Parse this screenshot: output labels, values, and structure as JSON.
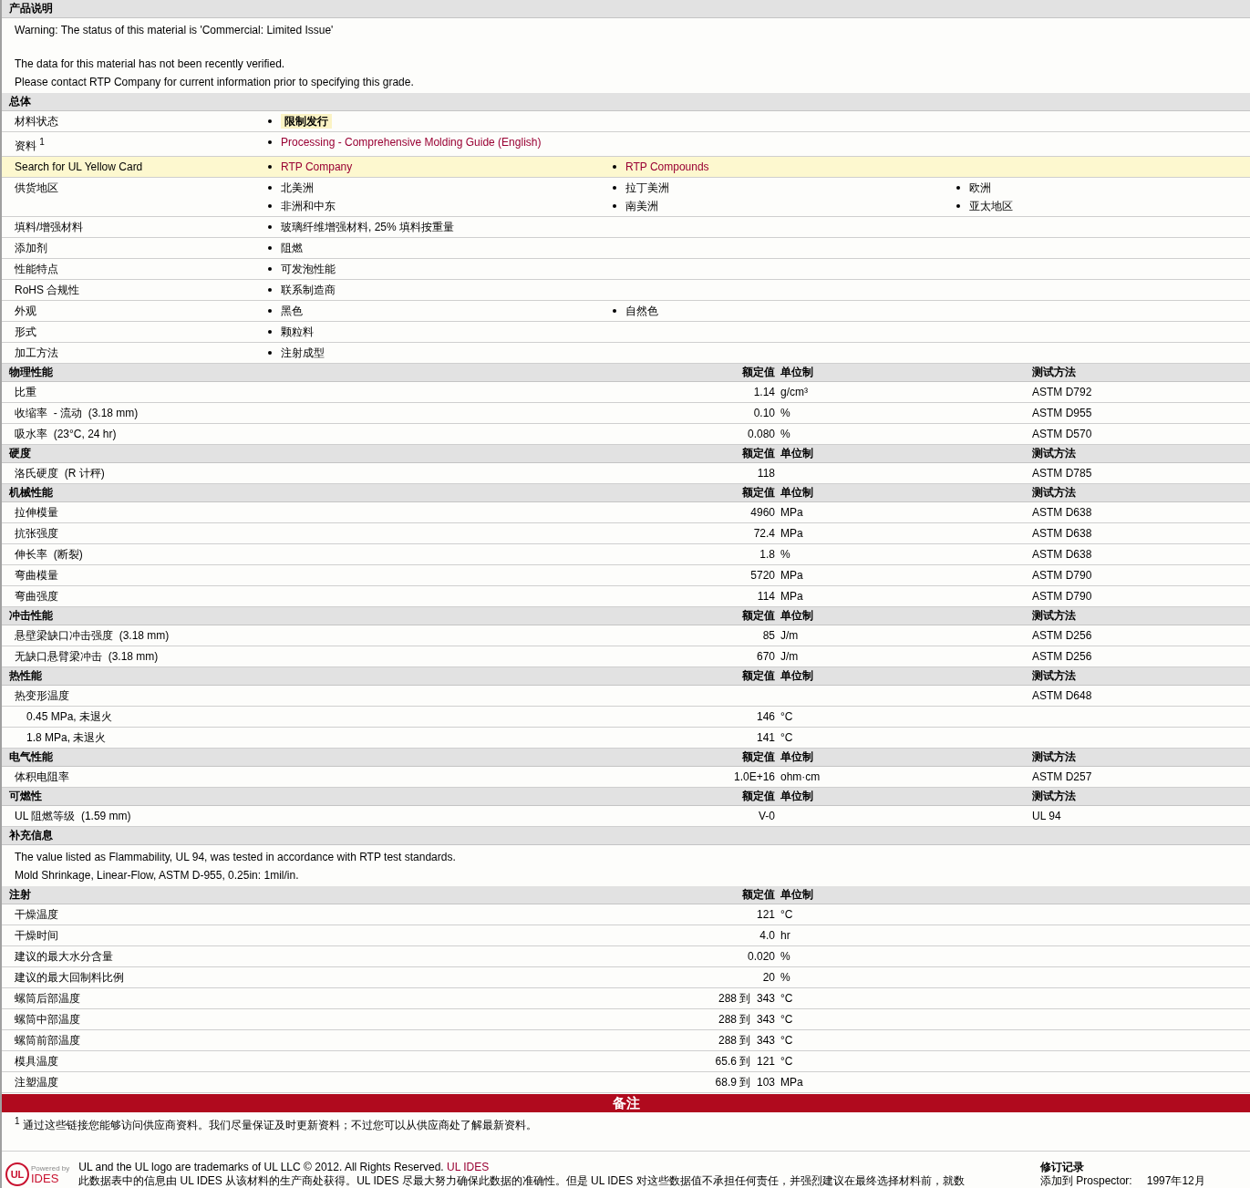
{
  "sections": [
    {
      "kind": "notes",
      "title": "产品说明",
      "paragraphs": [
        [
          "Warning: The status of this material is 'Commercial: Limited Issue'"
        ],
        [
          "The data for this material has not been recently verified.",
          "Please contact RTP Company for current information prior to specifying this grade."
        ]
      ]
    },
    {
      "kind": "general",
      "title": "总体",
      "rows": [
        {
          "label": "材料状态",
          "highlighted": false,
          "columns": [
            [
              {
                "kind": "status",
                "text": "限制发行"
              }
            ]
          ]
        },
        {
          "label": "资料 $^{1}$",
          "highlighted": false,
          "columns": [
            [
              {
                "kind": "link",
                "text": "Processing - Comprehensive Molding Guide (English)"
              }
            ]
          ]
        },
        {
          "label": "Search for UL Yellow Card",
          "highlighted": true,
          "columns": [
            [
              {
                "kind": "link",
                "text": "RTP Company"
              }
            ],
            [
              {
                "kind": "link",
                "text": "RTP Compounds"
              }
            ]
          ]
        },
        {
          "label": "供货地区",
          "highlighted": false,
          "columns": [
            [
              {
                "kind": "text",
                "text": "北美洲"
              },
              {
                "kind": "text",
                "text": "非洲和中东"
              }
            ],
            [
              {
                "kind": "text",
                "text": "拉丁美洲"
              },
              {
                "kind": "text",
                "text": "南美洲"
              }
            ],
            [
              {
                "kind": "text",
                "text": "欧洲"
              },
              {
                "kind": "text",
                "text": "亚太地区"
              }
            ]
          ]
        },
        {
          "label": "填料/增强材料",
          "highlighted": false,
          "columns": [
            [
              {
                "kind": "text",
                "text": "玻璃纤维增强材料, 25% 填料按重量"
              }
            ]
          ]
        },
        {
          "label": "添加剂",
          "highlighted": false,
          "columns": [
            [
              {
                "kind": "text",
                "text": "阻燃"
              }
            ]
          ]
        },
        {
          "label": "性能特点",
          "highlighted": false,
          "columns": [
            [
              {
                "kind": "text",
                "text": "可发泡性能"
              }
            ]
          ]
        },
        {
          "label": "RoHS 合规性",
          "highlighted": false,
          "columns": [
            [
              {
                "kind": "text",
                "text": "联系制造商"
              }
            ]
          ]
        },
        {
          "label": "外观",
          "highlighted": false,
          "columns": [
            [
              {
                "kind": "text",
                "text": "黑色"
              }
            ],
            [
              {
                "kind": "text",
                "text": "自然色"
              }
            ]
          ]
        },
        {
          "label": "形式",
          "highlighted": false,
          "columns": [
            [
              {
                "kind": "text",
                "text": "颗粒料"
              }
            ]
          ]
        },
        {
          "label": "加工方法",
          "highlighted": false,
          "columns": [
            [
              {
                "kind": "text",
                "text": "注射成型"
              }
            ]
          ]
        }
      ]
    },
    {
      "kind": "properties",
      "title": "物理性能",
      "headings": {
        "value": "额定值",
        "unit": "单位制",
        "method": "测试方法"
      },
      "rows": [
        {
          "label": "比重",
          "value": "1.14",
          "unit": "g/cm³",
          "method": "ASTM D792"
        },
        {
          "label": "收缩率  - 流动  (3.18 mm)",
          "value": "0.10",
          "unit": "%",
          "method": "ASTM D955"
        },
        {
          "label": "吸水率  (23°C, 24 hr)",
          "value": "0.080",
          "unit": "%",
          "method": "ASTM D570"
        }
      ]
    },
    {
      "kind": "properties",
      "title": "硬度",
      "headings": {
        "value": "额定值",
        "unit": "单位制",
        "method": "测试方法"
      },
      "rows": [
        {
          "label": "洛氏硬度  (R 计秤)",
          "value": "118",
          "method": "ASTM D785"
        }
      ]
    },
    {
      "kind": "properties",
      "title": "机械性能",
      "headings": {
        "value": "额定值",
        "unit": "单位制",
        "method": "测试方法"
      },
      "rows": [
        {
          "label": "拉伸模量",
          "value": "4960",
          "unit": "MPa",
          "method": "ASTM D638"
        },
        {
          "label": "抗张强度",
          "value": "72.4",
          "unit": "MPa",
          "method": "ASTM D638"
        },
        {
          "label": "伸长率  (断裂)",
          "value": "1.8",
          "unit": "%",
          "method": "ASTM D638"
        },
        {
          "label": "弯曲模量",
          "value": "5720",
          "unit": "MPa",
          "method": "ASTM D790"
        },
        {
          "label": "弯曲强度",
          "value": "114",
          "unit": "MPa",
          "method": "ASTM D790"
        }
      ]
    },
    {
      "kind": "properties",
      "title": "冲击性能",
      "headings": {
        "value": "额定值",
        "unit": "单位制",
        "method": "测试方法"
      },
      "rows": [
        {
          "label": "悬壁梁缺口冲击强度  (3.18 mm)",
          "value": "85",
          "unit": "J/m",
          "method": "ASTM D256"
        },
        {
          "label": "无缺口悬臂梁冲击  (3.18 mm)",
          "value": "670",
          "unit": "J/m",
          "method": "ASTM D256"
        }
      ]
    },
    {
      "kind": "properties",
      "title": "热性能",
      "headings": {
        "value": "额定值",
        "unit": "单位制",
        "method": "测试方法"
      },
      "rows": [
        {
          "label": "热变形温度",
          "method": "ASTM D648",
          "children": [
            {
              "label": "0.45 MPa, 未退火",
              "value": "146",
              "unit": "°C"
            },
            {
              "label": "1.8 MPa, 未退火",
              "value": "141",
              "unit": "°C"
            }
          ]
        }
      ]
    },
    {
      "kind": "properties",
      "title": "电气性能",
      "headings": {
        "value": "额定值",
        "unit": "单位制",
        "method": "测试方法"
      },
      "rows": [
        {
          "label": "体积电阻率",
          "value": "1.0E+16",
          "unit": "ohm·cm",
          "method": "ASTM D257"
        }
      ]
    },
    {
      "kind": "properties",
      "title": "可燃性",
      "headings": {
        "value": "额定值",
        "unit": "单位制",
        "method": "测试方法"
      },
      "rows": [
        {
          "label": "UL 阻燃等级  (1.59 mm)",
          "value": "V-0",
          "method": "UL 94"
        }
      ]
    },
    {
      "kind": "notes",
      "title": "补充信息",
      "paragraphs": [
        [
          "The value listed as Flammability, UL 94, was tested in accordance with RTP test standards.",
          "Mold Shrinkage, Linear-Flow, ASTM D-955, 0.25in: 1mil/in."
        ]
      ]
    },
    {
      "kind": "properties",
      "title": "注射",
      "headings": {
        "value": "额定值",
        "unit": "单位制"
      },
      "rows": [
        {
          "label": "干燥温度",
          "value": "121",
          "unit": "°C"
        },
        {
          "label": "干燥时间",
          "value": "4.0",
          "unit": "hr"
        },
        {
          "label": "建议的最大水分含量",
          "value": "0.020",
          "unit": "%"
        },
        {
          "label": "建议的最大回制料比例",
          "value": "20",
          "unit": "%"
        },
        {
          "label": "螺筒后部温度",
          "value": "288 到  343",
          "unit": "°C"
        },
        {
          "label": "螺筒中部温度",
          "value": "288 到  343",
          "unit": "°C"
        },
        {
          "label": "螺筒前部温度",
          "value": "288 到  343",
          "unit": "°C"
        },
        {
          "label": "模具温度",
          "value": "65.6 到  121",
          "unit": "°C"
        },
        {
          "label": "注塑温度",
          "value": "68.9 到  103",
          "unit": "MPa"
        }
      ]
    },
    {
      "kind": "remarks",
      "title": "备注",
      "footnote": "$^{1}$ 通过这些链接您能够访问供应商资料。我们尽量保证及时更新资料；不过您可以从供应商处了解最新资料。"
    }
  ],
  "footer": {
    "logo": {
      "powered": "Powered by",
      "mark": "UL",
      "name": "IDES"
    },
    "trademark": "UL and the UL logo are trademarks of UL LLC © 2012. All Rights Reserved.",
    "trademark_link": "UL IDES",
    "disclaimer": "此数据表中的信息由  UL IDES 从该材料的生产商处获得。UL IDES 尽最大努力确保此数据的准确性。但是  UL IDES 对这些数据值不承担任何责任，并强烈建议在最终选择材料前，就数",
    "revision_title": "修订记录",
    "revision_label": "添加到  Prospector:",
    "revision_date": "1997年12月"
  }
}
